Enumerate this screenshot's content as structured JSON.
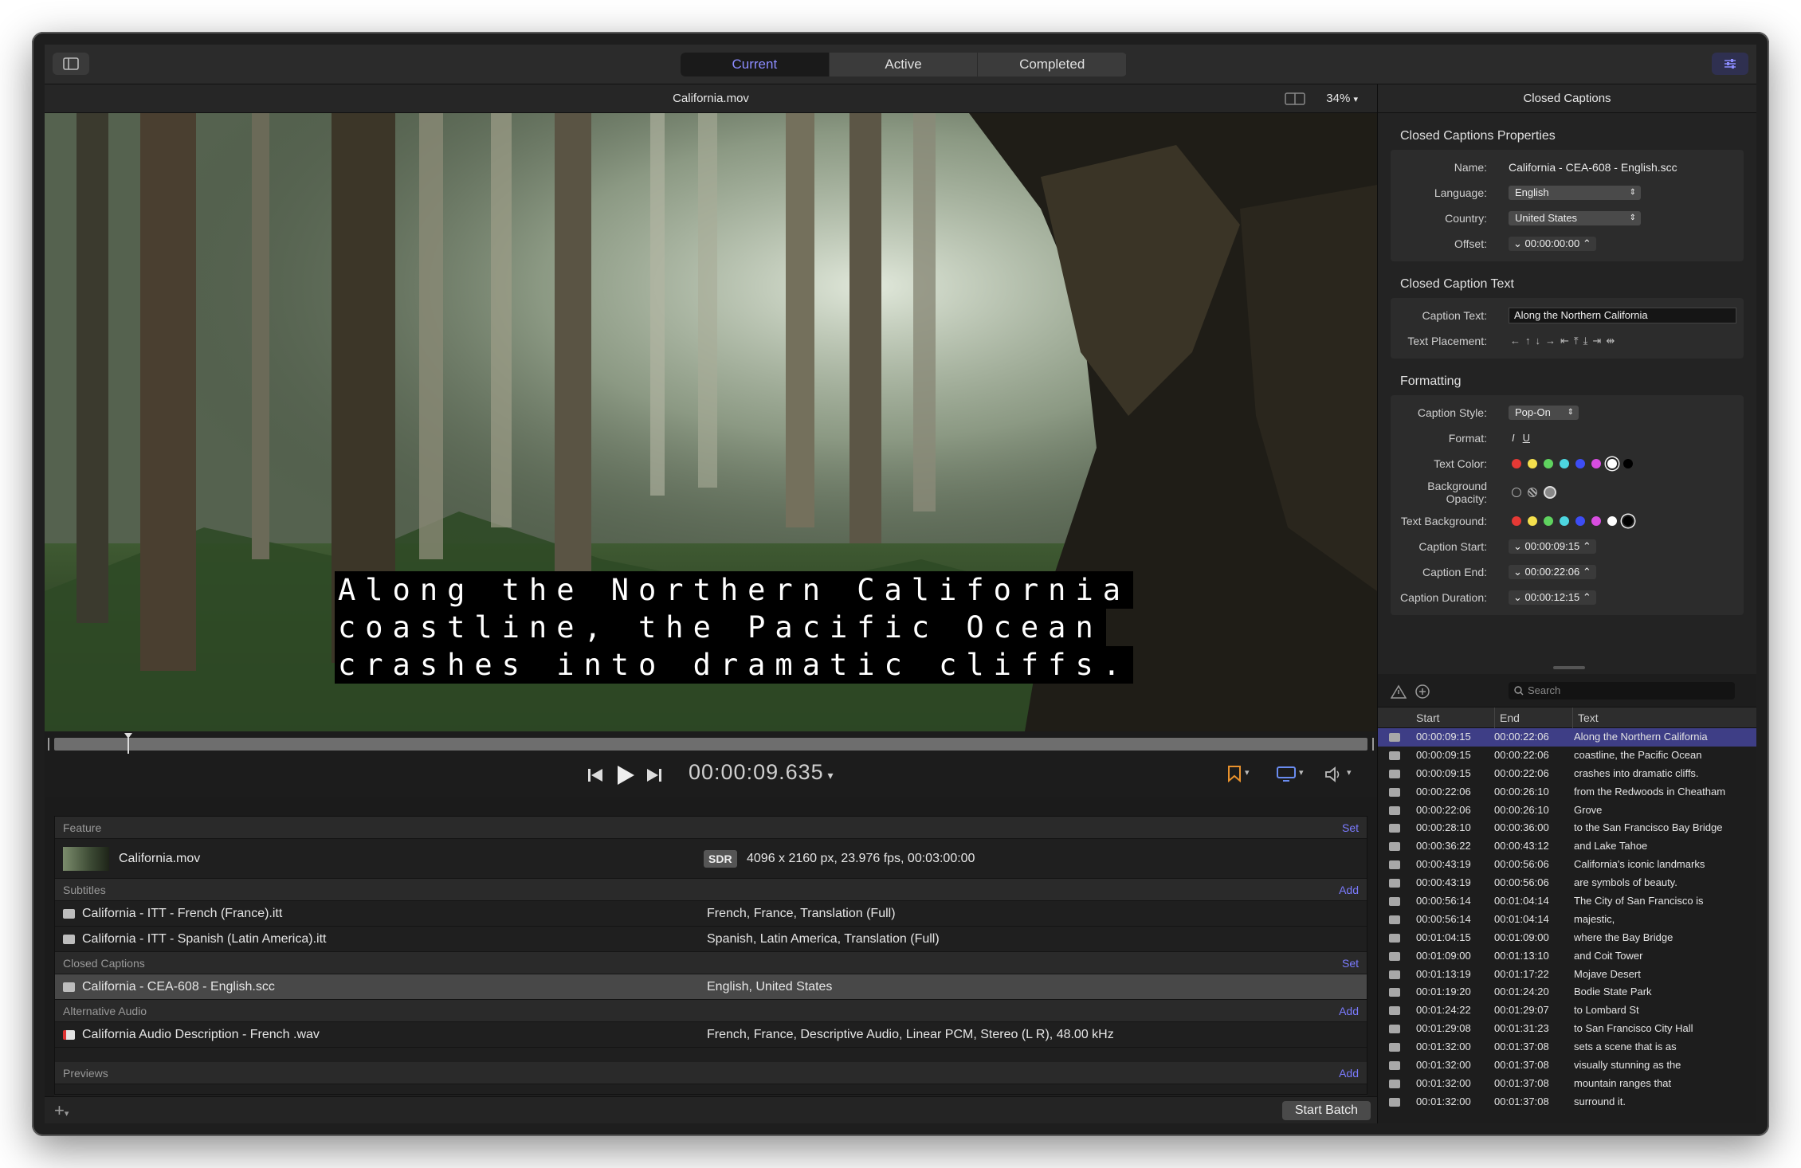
{
  "tabs": [
    {
      "label": "Current",
      "selected": true
    },
    {
      "label": "Active",
      "selected": false
    },
    {
      "label": "Completed",
      "selected": false
    }
  ],
  "viewer": {
    "file_name": "California.mov",
    "zoom": "34%",
    "caption_lines": [
      "Along the Northern California",
      "coastline, the Pacific Ocean",
      "crashes into dramatic cliffs."
    ],
    "timecode": "00:00:09.635"
  },
  "batch": {
    "feature": {
      "label": "Feature",
      "action": "Set",
      "name": "California.mov",
      "badge": "SDR",
      "info": "4096 x 2160 px, 23.976 fps, 00:03:00:00"
    },
    "subtitles": {
      "label": "Subtitles",
      "action": "Add",
      "items": [
        {
          "name": "California - ITT - French (France).itt",
          "info": "French, France, Translation (Full)"
        },
        {
          "name": "California - ITT - Spanish (Latin America).itt",
          "info": "Spanish, Latin America, Translation (Full)"
        }
      ]
    },
    "captions": {
      "label": "Closed Captions",
      "action": "Set",
      "name": "California - CEA-608 - English.scc",
      "info": "English, United States"
    },
    "audio": {
      "label": "Alternative Audio",
      "action": "Add",
      "name": "California Audio Description - French .wav",
      "info": "French, France, Descriptive Audio, Linear PCM, Stereo (L R), 48.00 kHz"
    },
    "previews": {
      "label": "Previews",
      "action": "Add"
    },
    "start_label": "Start Batch"
  },
  "inspector": {
    "title": "Closed Captions",
    "props_title": "Closed Captions Properties",
    "name_label": "Name:",
    "name_value": "California - CEA-608 - English.scc",
    "language_label": "Language:",
    "language_value": "English",
    "country_label": "Country:",
    "country_value": "United States",
    "offset_label": "Offset:",
    "offset_value": "00:00:00:00",
    "text_title": "Closed Caption Text",
    "caption_text_label": "Caption Text:",
    "caption_text_value": "Along the Northern California",
    "placement_label": "Text Placement:",
    "format_title": "Formatting",
    "style_label": "Caption Style:",
    "style_value": "Pop-On",
    "format_label": "Format:",
    "format_italic": "I",
    "format_underline": "U",
    "text_color_label": "Text Color:",
    "bg_opacity_label_1": "Background",
    "bg_opacity_label_2": "Opacity:",
    "text_bg_label": "Text Background:",
    "start_label": "Caption Start:",
    "start_value": "00:00:09:15",
    "end_label": "Caption End:",
    "end_value": "00:00:22:06",
    "duration_label": "Caption Duration:",
    "duration_value": "00:00:12:15",
    "colors": [
      "#e53935",
      "#f4e04d",
      "#5fd35f",
      "#4dd6e0",
      "#3d4df5",
      "#d84de0",
      "#ffffff",
      "#000000"
    ]
  },
  "caption_list": {
    "search_placeholder": "Search",
    "headers": {
      "start": "Start",
      "end": "End",
      "text": "Text"
    },
    "rows": [
      {
        "start": "00:00:09:15",
        "end": "00:00:22:06",
        "text": "Along the Northern California",
        "selected": true
      },
      {
        "start": "00:00:09:15",
        "end": "00:00:22:06",
        "text": "coastline, the Pacific Ocean"
      },
      {
        "start": "00:00:09:15",
        "end": "00:00:22:06",
        "text": "crashes into dramatic cliffs."
      },
      {
        "start": "00:00:22:06",
        "end": "00:00:26:10",
        "text": "from the Redwoods in Cheatham"
      },
      {
        "start": "00:00:22:06",
        "end": "00:00:26:10",
        "text": "Grove"
      },
      {
        "start": "00:00:28:10",
        "end": "00:00:36:00",
        "text": "to the San Francisco Bay Bridge"
      },
      {
        "start": "00:00:36:22",
        "end": "00:00:43:12",
        "text": "and Lake Tahoe"
      },
      {
        "start": "00:00:43:19",
        "end": "00:00:56:06",
        "text": "California's iconic landmarks"
      },
      {
        "start": "00:00:43:19",
        "end": "00:00:56:06",
        "text": "are symbols of beauty."
      },
      {
        "start": "00:00:56:14",
        "end": "00:01:04:14",
        "text": "The City of San Francisco is"
      },
      {
        "start": "00:00:56:14",
        "end": "00:01:04:14",
        "text": "majestic,"
      },
      {
        "start": "00:01:04:15",
        "end": "00:01:09:00",
        "text": "where the Bay Bridge"
      },
      {
        "start": "00:01:09:00",
        "end": "00:01:13:10",
        "text": "and Coit Tower"
      },
      {
        "start": "00:01:13:19",
        "end": "00:01:17:22",
        "text": "Mojave Desert"
      },
      {
        "start": "00:01:19:20",
        "end": "00:01:24:20",
        "text": "Bodie State Park"
      },
      {
        "start": "00:01:24:22",
        "end": "00:01:29:07",
        "text": "to Lombard St"
      },
      {
        "start": "00:01:29:08",
        "end": "00:01:31:23",
        "text": "to San Francisco City Hall"
      },
      {
        "start": "00:01:32:00",
        "end": "00:01:37:08",
        "text": "sets a scene that is as"
      },
      {
        "start": "00:01:32:00",
        "end": "00:01:37:08",
        "text": "visually stunning as the"
      },
      {
        "start": "00:01:32:00",
        "end": "00:01:37:08",
        "text": "mountain ranges that"
      },
      {
        "start": "00:01:32:00",
        "end": "00:01:37:08",
        "text": "surround it."
      }
    ]
  },
  "icons": [
    "sidebar-toggle-icon",
    "inspector-toggle-icon",
    "skip-back-icon",
    "play-icon",
    "skip-forward-icon",
    "bookmark-icon",
    "display-icon",
    "volume-icon",
    "warning-icon",
    "add-circle-icon",
    "search-icon",
    "caption-icon",
    "audio-file-icon",
    "plus-icon"
  ]
}
